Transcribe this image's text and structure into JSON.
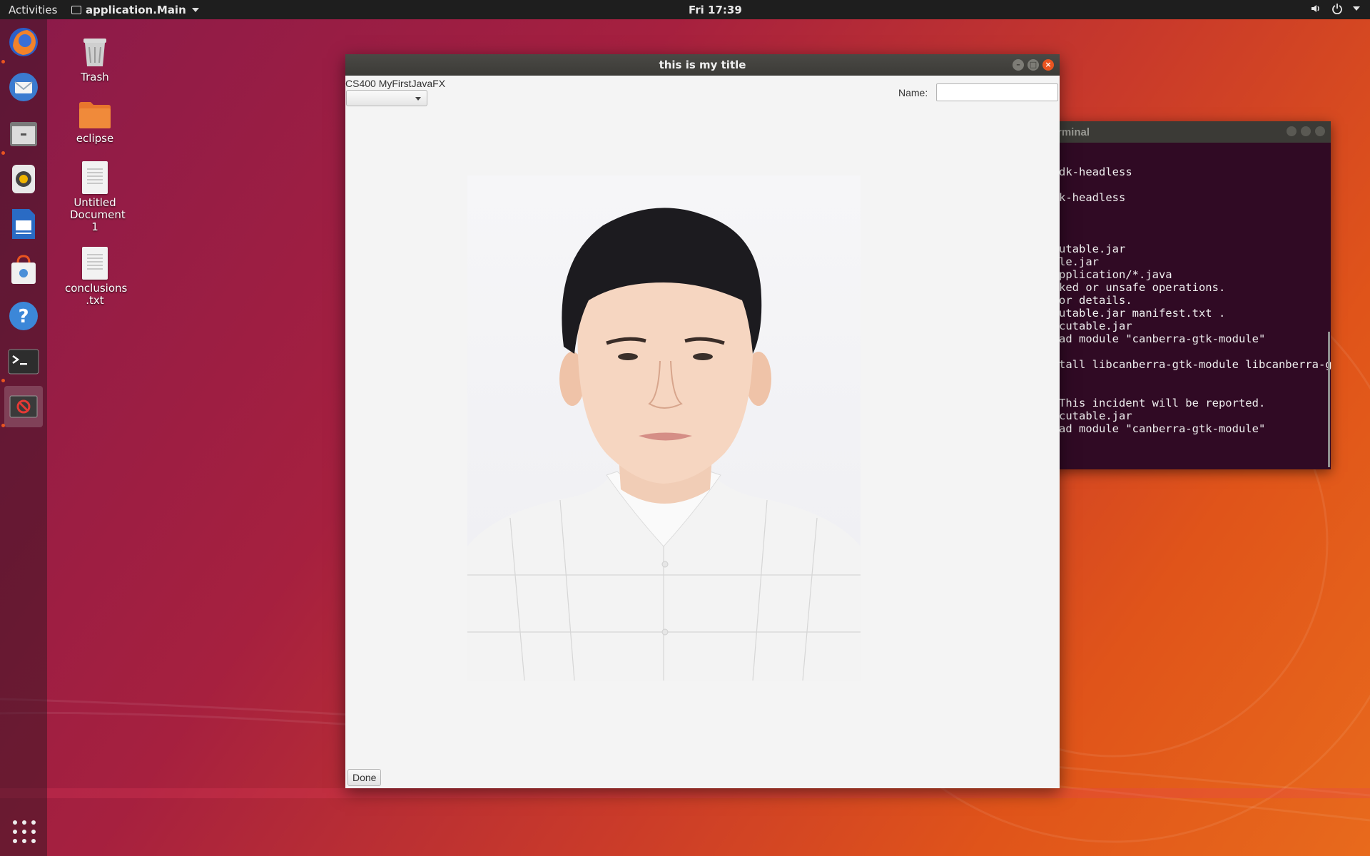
{
  "topbar": {
    "activities": "Activities",
    "app_name": "application.Main",
    "clock": "Fri 17:39"
  },
  "dock": {
    "items": [
      "firefox-icon",
      "thunderbird-icon",
      "files-icon",
      "rhythmbox-icon",
      "writer-icon",
      "software-center-icon",
      "help-icon",
      "terminal-icon",
      "java-app-icon"
    ]
  },
  "desktop": {
    "icons": [
      {
        "label": "Trash"
      },
      {
        "label": "eclipse"
      },
      {
        "label": "Untitled Document 1"
      },
      {
        "label": "conclusions .txt"
      }
    ]
  },
  "terminal": {
    "title": "rminal",
    "lines": [
      "dk-headless",
      "",
      "k-headless",
      "",
      "",
      "",
      "utable.jar",
      "le.jar",
      "pplication/*.java",
      "ked or unsafe operations.",
      "or details.",
      "utable.jar manifest.txt .",
      "cutable.jar",
      "ad module \"canberra-gtk-module\"",
      "",
      "tall libcanberra-gtk-module libcanberra-g",
      "",
      "",
      "This incident will be reported.",
      "cutable.jar",
      "ad module \"canberra-gtk-module\""
    ]
  },
  "fxwindow": {
    "title": "this is my title",
    "header_label": "CS400 MyFirstJavaFX",
    "combo_value": "",
    "name_label": "Name:",
    "name_value": "",
    "done_label": "Done",
    "image": "portrait-photo"
  },
  "colors": {
    "ubuntu_orange": "#e95420",
    "terminal_bg": "#300a24",
    "titlebar": "#3c3b37"
  }
}
